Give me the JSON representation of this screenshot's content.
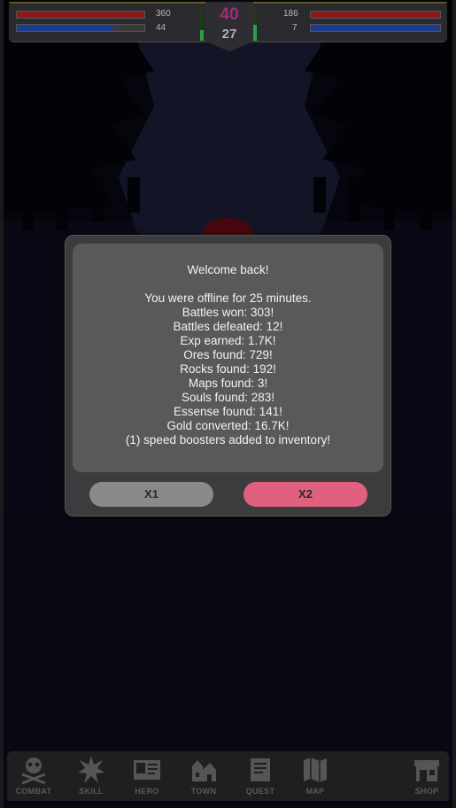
{
  "hud": {
    "left": {
      "hp_value": "360",
      "mp_value": "44",
      "hp_fraction": 1.0,
      "mp_fraction": 0.75
    },
    "right": {
      "hp_value": "186",
      "mp_value": "7",
      "hp_fraction": 1.0,
      "mp_fraction": 1.0
    },
    "level_top": "40",
    "level_bottom": "27",
    "colors": {
      "hp": "#8b1a1a",
      "mp": "#1c3c8c",
      "level_top": "#9a2f7a",
      "level_bottom": "#b0b0b0"
    }
  },
  "modal": {
    "title": "Welcome back!",
    "lines": [
      "You were offline for 25 minutes.",
      "Battles won: 303!",
      "Battles defeated: 12!",
      "Exp earned: 1.7K!",
      "Ores found: 729!",
      "Rocks found: 192!",
      "Maps found: 3!",
      "Souls found: 283!",
      "Essense found: 141!",
      "Gold converted: 16.7K!",
      "(1) speed boosters added to inventory!"
    ],
    "button_x1": "X1",
    "button_x2": "X2"
  },
  "nav": {
    "items": [
      {
        "label": "COMBAT",
        "icon": "skull-crossbones-icon"
      },
      {
        "label": "SKILL",
        "icon": "burst-icon"
      },
      {
        "label": "HERO",
        "icon": "id-card-icon"
      },
      {
        "label": "TOWN",
        "icon": "town-icon"
      },
      {
        "label": "QUEST",
        "icon": "scroll-icon"
      },
      {
        "label": "MAP",
        "icon": "map-icon"
      },
      {
        "label": "SHOP",
        "icon": "shop-icon"
      }
    ]
  }
}
